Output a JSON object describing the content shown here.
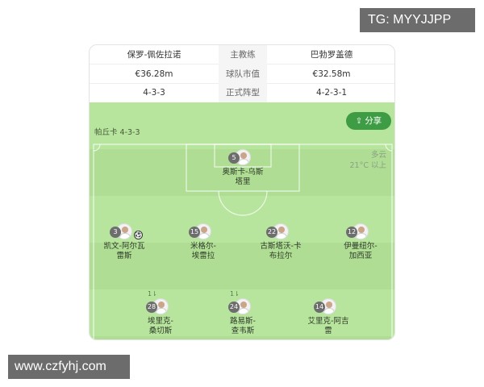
{
  "watermarks": {
    "top": "TG: MYYJJPP",
    "bottom": "www.czfyhj.com"
  },
  "stats": {
    "rows": [
      {
        "left": "保罗-佩佐拉诺",
        "label": "主教练",
        "right": "巴勃罗盖德"
      },
      {
        "left": "€36.28m",
        "label": "球队市值",
        "right": "€32.58m"
      },
      {
        "left": "4-3-3",
        "label": "正式阵型",
        "right": "4-2-3-1"
      }
    ]
  },
  "pitch": {
    "team_label": "帕丘卡 4-3-3",
    "share_label": "分享",
    "share_icon": "share-icon",
    "weather": {
      "condition": "多云",
      "temperature": "21°C 以上"
    },
    "colors": {
      "grass_light": "#b7e59d",
      "grass_dark": "#aedd93",
      "share_bg": "#3e9d44"
    },
    "players": [
      {
        "number": "5",
        "name_line1": "奥斯卡-乌斯",
        "name_line2": "塔里",
        "sub_mark": ""
      },
      {
        "number": "3",
        "name_line1": "凯文-阿尔瓦",
        "name_line2": "雷斯",
        "sub_mark": "",
        "ball_icon": "⚽"
      },
      {
        "number": "15",
        "name_line1": "米格尔-",
        "name_line2": "埃雷拉",
        "sub_mark": ""
      },
      {
        "number": "22",
        "name_line1": "古斯塔沃-卡",
        "name_line2": "布拉尔",
        "sub_mark": ""
      },
      {
        "number": "12",
        "name_line1": "伊曼纽尔-",
        "name_line2": "加西亚",
        "sub_mark": ""
      },
      {
        "number": "28",
        "name_line1": "埃里克-",
        "name_line2": "桑切斯",
        "sub_mark": "1⇂"
      },
      {
        "number": "24",
        "name_line1": "路易斯-",
        "name_line2": "查韦斯",
        "sub_mark": "1⇂"
      },
      {
        "number": "14",
        "name_line1": "艾里克-阿吉",
        "name_line2": "雷",
        "sub_mark": ""
      }
    ]
  }
}
